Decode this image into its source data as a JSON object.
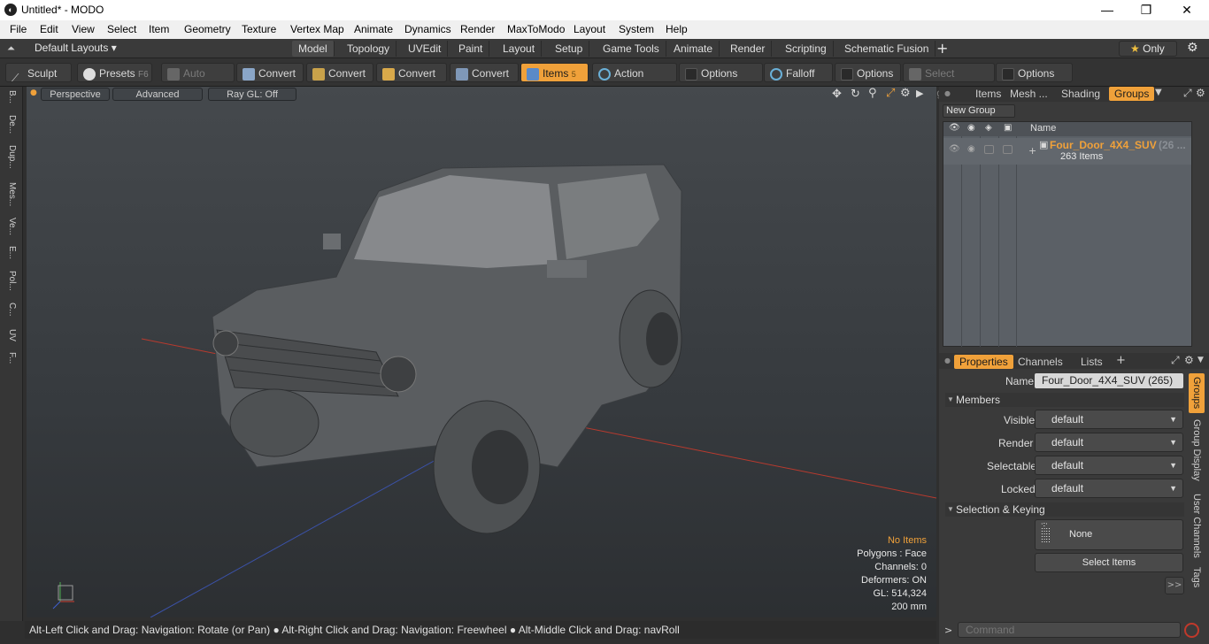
{
  "window": {
    "title": "Untitled* - MODO",
    "minimize": "—",
    "restore": "❐",
    "close": "✕"
  },
  "menu": [
    "File",
    "Edit",
    "View",
    "Select",
    "Item",
    "Geometry",
    "Texture",
    "Vertex Map",
    "Animate",
    "Dynamics",
    "Render",
    "MaxToModo",
    "Layout",
    "System",
    "Help"
  ],
  "layout_bar": {
    "layouts_label": "Default Layouts",
    "tabs": [
      "Model",
      "Topology",
      "UVEdit",
      "Paint",
      "Layout",
      "Setup",
      "Game Tools",
      "Animate",
      "Render",
      "Scripting",
      "Schematic Fusion"
    ],
    "active_tab": "Model",
    "add": "+",
    "only_label": "Only"
  },
  "toolbar": {
    "sculpt": "Sculpt",
    "presets": "Presets",
    "presets_key": "F6",
    "auto_select": "Auto Select",
    "convert1": "Convert",
    "convert2": "Convert",
    "convert3": "Convert",
    "convert4": "Convert",
    "items": "Items",
    "items_key": "5",
    "action_center": "Action Center",
    "options1": "Options",
    "falloff": "Falloff",
    "options2": "Options",
    "select_through": "Select Through",
    "options3": "Options"
  },
  "left_tabs": [
    "B...",
    "De...",
    "Dup...",
    "Mes...",
    "Ve...",
    "E...",
    "Pol...",
    "C...",
    "UV",
    "F..."
  ],
  "viewport": {
    "perspective": "Perspective",
    "advanced": "Advanced",
    "raygl": "Ray GL: Off",
    "info": {
      "no_items": "No Items",
      "polygons": "Polygons : Face",
      "channels": "Channels: 0",
      "deformers": "Deformers: ON",
      "gl": "GL: 514,324",
      "scale": "200 mm"
    }
  },
  "status": "Alt-Left Click and Drag: Navigation: Rotate (or Pan) ● Alt-Right Click and Drag: Navigation: Freewheel ● Alt-Middle Click and Drag: navRoll",
  "groups_panel": {
    "tabs": [
      "Items",
      "Mesh ...",
      "Shading",
      "Groups"
    ],
    "active_tab": "Groups",
    "new_group": "New Group",
    "col_name": "Name",
    "group_name": "Four_Door_4X4_SUV",
    "group_count_suffix": "(26 ...",
    "group_items": "263 Items"
  },
  "properties_panel": {
    "tabs": [
      "Properties",
      "Channels",
      "Lists"
    ],
    "active_tab": "Properties",
    "add": "+",
    "name_label": "Name",
    "name_value": "Four_Door_4X4_SUV (265)",
    "members_head": "Members",
    "visible_label": "Visible",
    "visible_value": "default",
    "render_label": "Render",
    "render_value": "default",
    "selectable_label": "Selectable",
    "selectable_value": "default",
    "locked_label": "Locked",
    "locked_value": "default",
    "selkey_head": "Selection & Keying",
    "none_label": "None",
    "select_items": "Select Items",
    "more": ">>",
    "side_tabs": [
      "Groups",
      "Group Display",
      "User Channels",
      "Tags"
    ]
  },
  "command": {
    "placeholder": "Command",
    "prompt": ">"
  },
  "colors": {
    "accent": "#f0a13a",
    "group_name": "#f0a13a"
  }
}
